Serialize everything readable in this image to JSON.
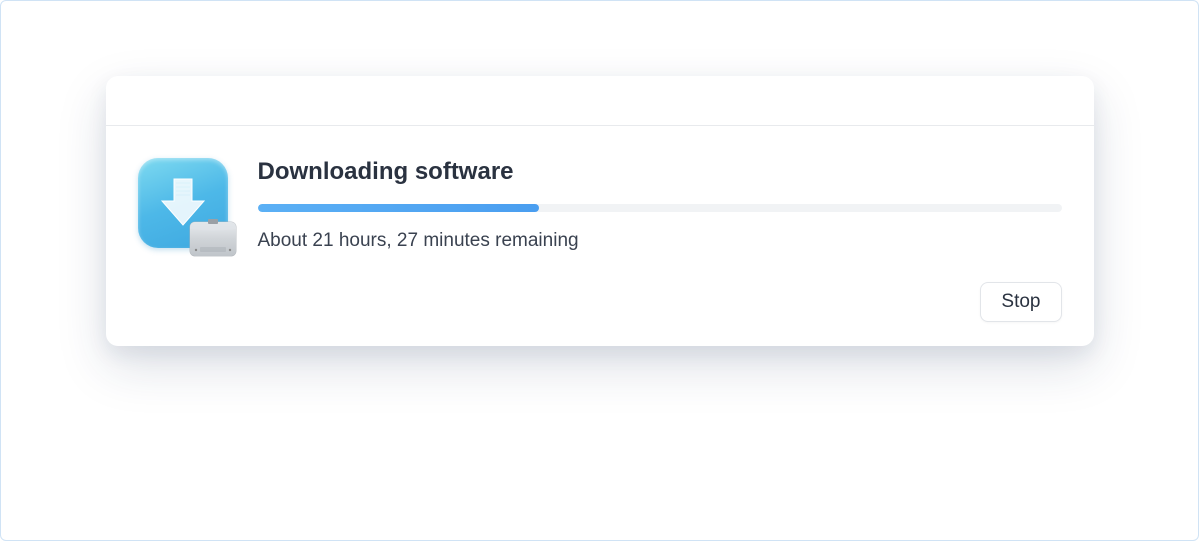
{
  "dialog": {
    "title": "Downloading software",
    "status": "About 21 hours, 27 minutes remaining",
    "progress_percent": 35,
    "stop_label": "Stop"
  }
}
